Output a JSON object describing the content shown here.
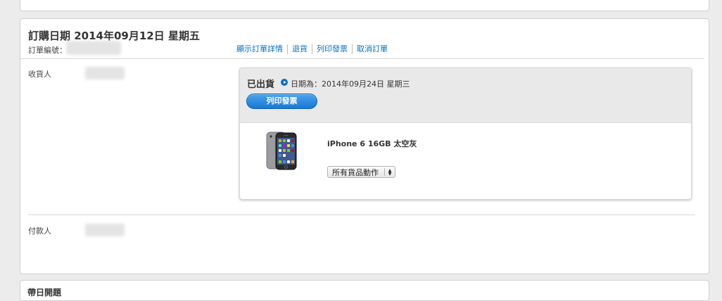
{
  "order": {
    "date_heading": "訂購日期 2014年09月12日 星期五",
    "number_label": "訂單編號：",
    "actions": [
      {
        "label": "顯示訂單詳情"
      },
      {
        "label": "退貨"
      },
      {
        "label": "列印發票"
      },
      {
        "label": "取消訂單"
      }
    ]
  },
  "recipient": {
    "label": "收貨人"
  },
  "payer": {
    "label": "付款人"
  },
  "shipment": {
    "status": "已出貨",
    "date_text": "日期為：2014年09月24日 星期三",
    "print_button": "列印發票",
    "product": {
      "name": "iPhone 6 16GB 太空灰",
      "actions_select": "所有貨品動作",
      "image_icon": "iphone-icon"
    }
  },
  "next_panel": {
    "title": "帶日開題"
  },
  "colors": {
    "link": "#0070c9",
    "button": "#1a78d2",
    "background": "#ececec"
  }
}
